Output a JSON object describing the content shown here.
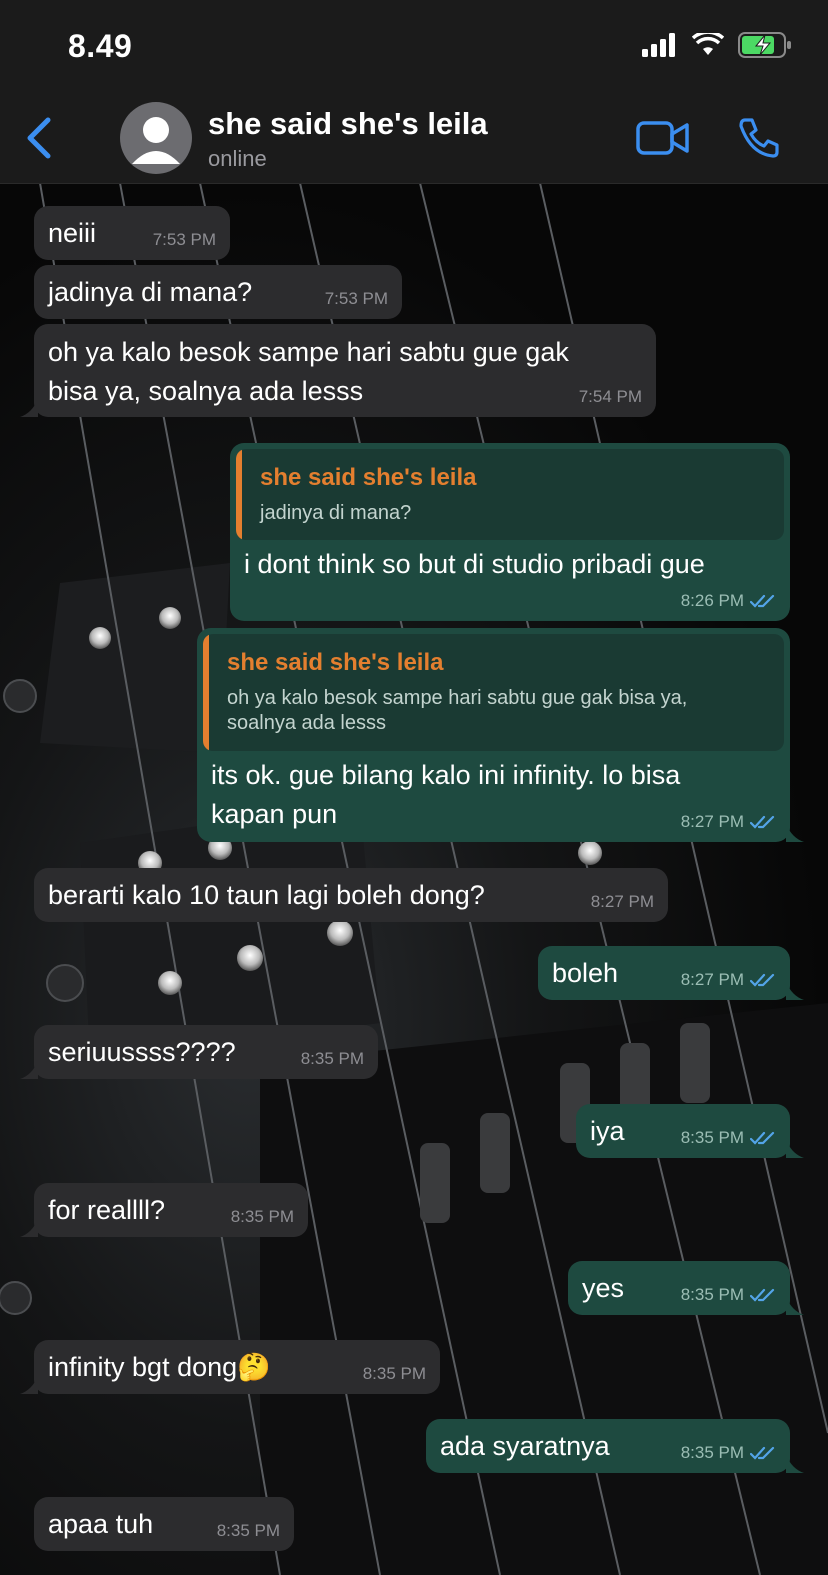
{
  "status_bar": {
    "time": "8.49"
  },
  "header": {
    "contact_name": "she said she's leila",
    "status": "online"
  },
  "messages": [
    {
      "dir": "in",
      "text": "neiii",
      "time": "7:53 PM"
    },
    {
      "dir": "in",
      "text": "jadinya di mana?",
      "time": "7:53 PM"
    },
    {
      "dir": "in",
      "lines": [
        "oh ya kalo besok sampe hari sabtu gue gak",
        "bisa ya, soalnya ada lesss"
      ],
      "time": "7:54 PM"
    },
    {
      "dir": "out",
      "quote_name": "she said she's leila",
      "quote_text": "jadinya di mana?",
      "text": "i dont think so but di studio pribadi gue",
      "time": "8:26 PM"
    },
    {
      "dir": "out",
      "quote_name": "she said she's leila",
      "quote_lines": [
        "oh ya kalo besok sampe hari sabtu gue gak bisa ya,",
        "soalnya ada lesss"
      ],
      "lines": [
        "its ok. gue bilang kalo ini infinity. lo bisa",
        "kapan pun"
      ],
      "time": "8:27 PM"
    },
    {
      "dir": "in",
      "text": "berarti kalo 10 taun lagi boleh dong?",
      "time": "8:27 PM"
    },
    {
      "dir": "out",
      "text": "boleh",
      "time": "8:27 PM"
    },
    {
      "dir": "in",
      "text": "seriuussss????",
      "time": "8:35 PM"
    },
    {
      "dir": "out",
      "text": "iya",
      "time": "8:35 PM"
    },
    {
      "dir": "in",
      "text": "for reallll?",
      "time": "8:35 PM"
    },
    {
      "dir": "out",
      "text": "yes",
      "time": "8:35 PM"
    },
    {
      "dir": "in",
      "text": "infinity bgt dong🤔",
      "time": "8:35 PM"
    },
    {
      "dir": "out",
      "text": "ada syaratnya",
      "time": "8:35 PM"
    },
    {
      "dir": "in",
      "text": "apaa tuh",
      "time": "8:35 PM"
    }
  ],
  "icons": {
    "back": "chevron-left-icon",
    "avatar": "person-icon",
    "video": "video-camera-icon",
    "call": "phone-icon",
    "read": "double-check-icon"
  },
  "colors": {
    "accent": "#3b8ef0",
    "incoming_bubble": "#2c2c2e",
    "outgoing_bubble": "#1e4a40",
    "quote_name": "#e47f2f",
    "read_ticks": "#53a4e8"
  }
}
